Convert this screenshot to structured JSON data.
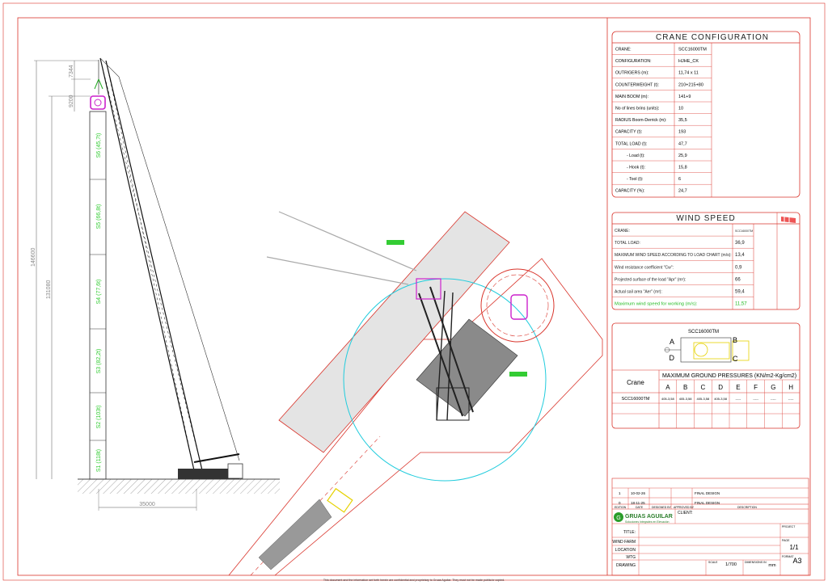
{
  "config": {
    "title": "CRANE CONFIGURATION",
    "rows": [
      {
        "label": "CRANE:",
        "value": "SCC16000TM"
      },
      {
        "label": "CONFIGURATION:",
        "value": "HJHE_CK"
      },
      {
        "label": "OUTRIGERS (m):",
        "value": "11,74 x 11"
      },
      {
        "label": "COUNTERWEIGHT (t):",
        "value": "210+215+80"
      },
      {
        "label": "MAIN BOOM (m):",
        "value": "141+9"
      },
      {
        "label": "No of lines brins (units):",
        "value": "10"
      },
      {
        "label": "RADIUS Boom-Derrick (m):",
        "value": "35,5"
      },
      {
        "label": "CAPACITY (t):",
        "value": "193"
      },
      {
        "label": "TOTAL LOAD (t):",
        "value": "47,7"
      },
      {
        "label": "- Load (t):",
        "value": "25,9"
      },
      {
        "label": "- Hook (t):",
        "value": "15,8"
      },
      {
        "label": "- Tool (t):",
        "value": "6"
      },
      {
        "label": "CAPACITY (%):",
        "value": "24,7"
      }
    ]
  },
  "wind": {
    "title": "WIND SPEED",
    "rows": [
      {
        "label": "CRANE:",
        "value": "SCC16000TM"
      },
      {
        "label": "TOTAL LOAD:",
        "value": "36,9"
      },
      {
        "label": "MAXIMUM WIND SPEED ACCORDING TO LOAD CHART (m/s):",
        "value": "13,4"
      },
      {
        "label": "Wind resistance coefficient \"Cw\":",
        "value": "0,9"
      },
      {
        "label": "Projected surface of the load \"Apr\" (m²):",
        "value": "66"
      },
      {
        "label": "Actual sail area \"Aer\" (m²):",
        "value": "59,4"
      },
      {
        "label": "Maximum wind speed for working (m/s):",
        "value": "11,57"
      }
    ]
  },
  "pressure": {
    "crane_label": "SCC16000TM",
    "corners": [
      "A",
      "B",
      "C",
      "D"
    ],
    "col_crane": "Crane",
    "header": "MAXIMUM GROUND PRESSURES (KN/m2-Kg/cm2)",
    "cols": [
      "A",
      "B",
      "C",
      "D",
      "E",
      "F",
      "G",
      "H"
    ],
    "row_name": "SCC16000TM",
    "row_values": [
      "405-3,58",
      "405-3,58",
      "405-3,58",
      "405-3,58",
      "-----",
      "-----",
      "-----",
      "-----"
    ]
  },
  "revisions": [
    {
      "n": "1",
      "date": "10-02-26",
      "desc": "FINAL DESIGN"
    },
    {
      "n": "0",
      "date": "18-11-25",
      "desc": "FINAL DESIGN"
    }
  ],
  "rev_header": {
    "edition": "EDITION",
    "date": "DATE",
    "designed": "DESIGNED BY",
    "approved": "APPROVED BY",
    "description": "DESCRIPTION"
  },
  "titleblock": {
    "company": "GRUAS AGUILAR",
    "tagline": "Soluciones Integrales en Elevación",
    "client": "CLIENT:",
    "project": "PROJECT",
    "title": "TITLE:",
    "windfarm": "WIND FARM",
    "location": "LOCATION",
    "wtg": "WTG",
    "drawing": "DRAWING",
    "page_label": "PAGE",
    "page": "1/1",
    "scale_label": "SCALE",
    "scale": "1/700",
    "dims_label": "DIMENSIONS IN",
    "dims": "mm",
    "format_label": "FORMAT",
    "format": "A3"
  },
  "footer": "This document and the information set forth herein are confidential and proprietary to Gruas Aguilar. They must not be made public/or copied.",
  "elevation": {
    "sections": [
      "S1 (118t)",
      "S2 (103t)",
      "S3 (82,2t)",
      "S4 (77,6t)",
      "S5 (66,8t)",
      "S6 (45,7t)"
    ],
    "dims": [
      "146600",
      "131080",
      "9200",
      "7344"
    ],
    "radius": "35000"
  },
  "colors": {
    "frame": "#d9342b",
    "accent_green": "#33cc33",
    "wind_green": "#22bb22",
    "magenta": "#cc22cc",
    "cyan": "#22ccdd"
  }
}
